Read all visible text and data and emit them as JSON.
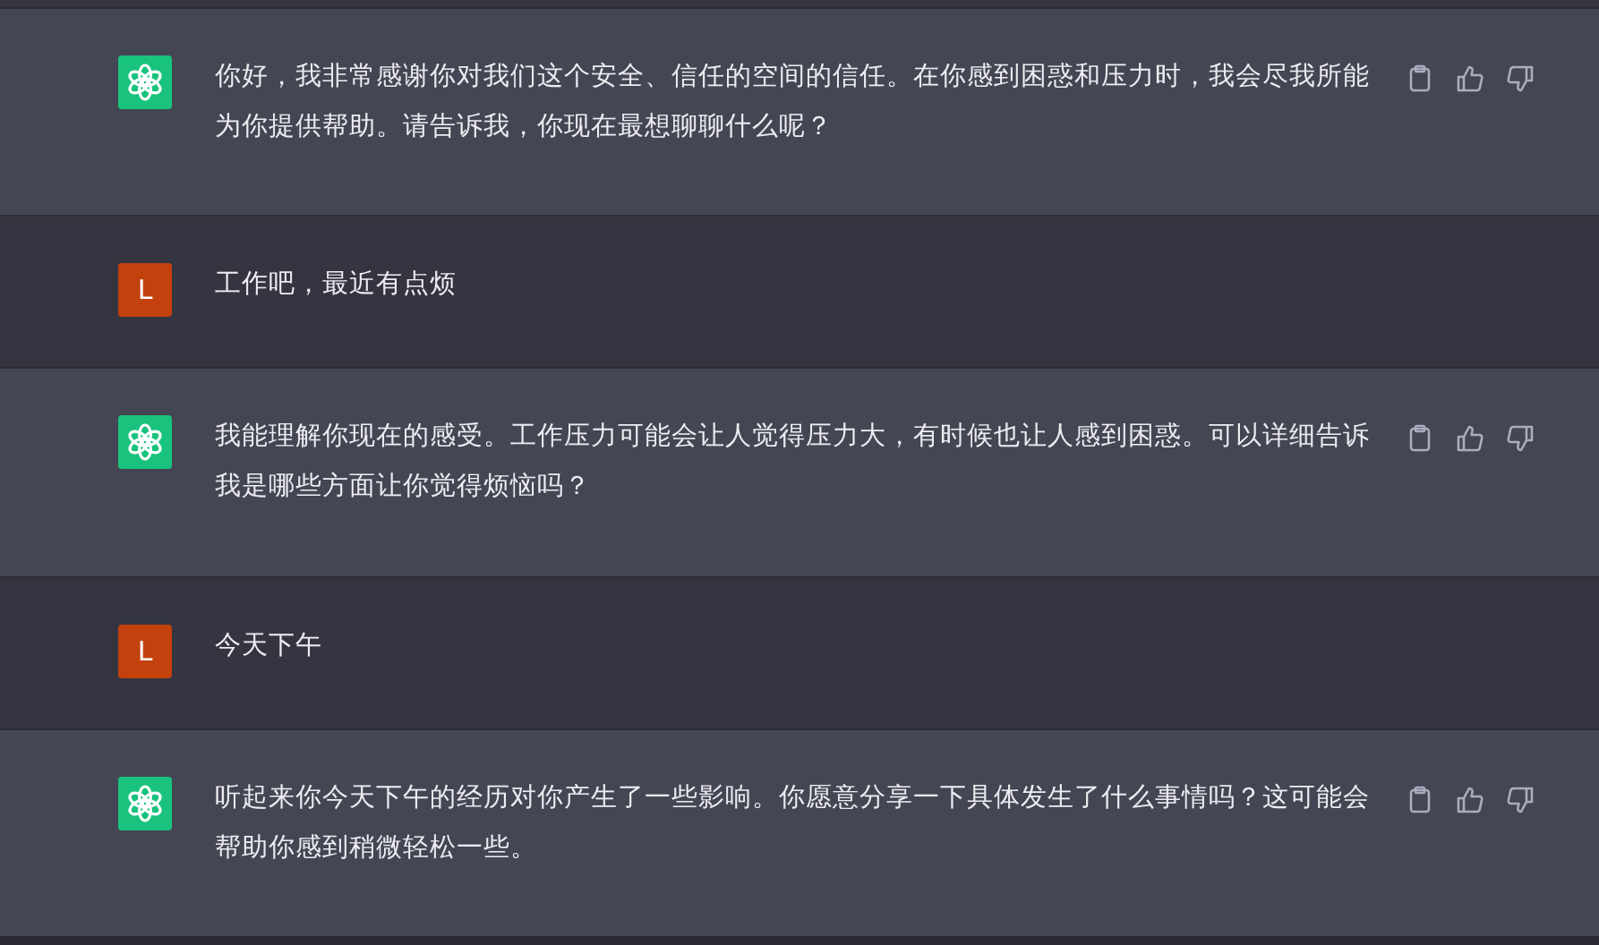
{
  "messages": [
    {
      "kind": "assistant",
      "text": "你好，我非常感谢你对我们这个安全、信任的空间的信任。在你感到困惑和压力时，我会尽我所能为你提供帮助。请告诉我，你现在最想聊聊什么呢？"
    },
    {
      "kind": "user",
      "avatar": "L",
      "text": "工作吧，最近有点烦"
    },
    {
      "kind": "assistant",
      "text": "我能理解你现在的感受。工作压力可能会让人觉得压力大，有时候也让人感到困惑。可以详细告诉我是哪些方面让你觉得烦恼吗？"
    },
    {
      "kind": "user",
      "avatar": "L",
      "text": "今天下午"
    },
    {
      "kind": "assistant",
      "text": "听起来你今天下午的经历对你产生了一些影响。你愿意分享一下具体发生了什么事情吗？这可能会帮助你感到稍微轻松一些。"
    }
  ]
}
